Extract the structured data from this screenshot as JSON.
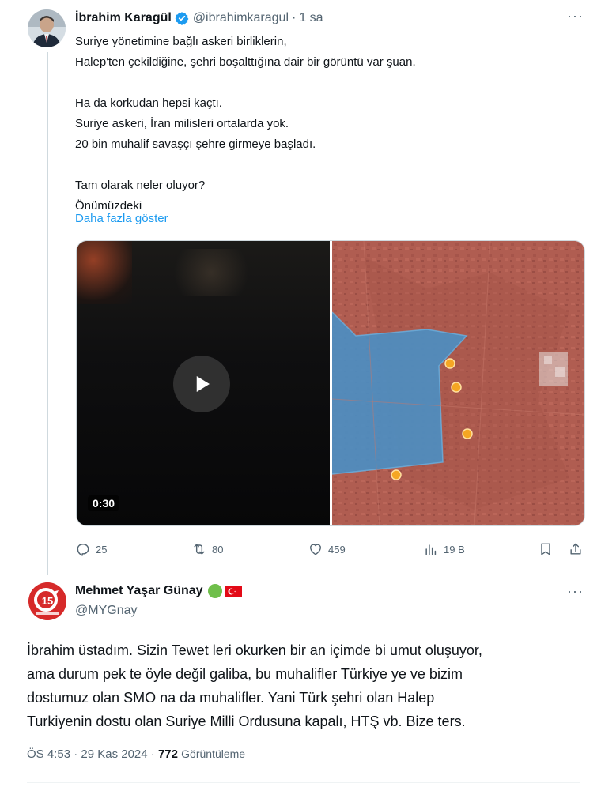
{
  "tweet": {
    "author_name": "İbrahim Karagül",
    "handle": "@ibrahimkaragul",
    "separator": "·",
    "time": "1 sa",
    "lines": [
      "Suriye yönetimine bağlı askeri birliklerin,",
      "Halep'ten çekildiğine, şehri boşalttığına dair bir görüntü var şuan.",
      "",
      "Ha da korkudan hepsi kaçtı.",
      "Suriye askeri, İran milisleri ortalarda yok.",
      "20 bin muhalif savaşçı şehre girmeye başladı.",
      "",
      "Tam olarak neler oluyor?",
      "Önümüzdeki"
    ],
    "show_more": "Daha fazla göster",
    "video_duration": "0:30",
    "replies": "25",
    "reposts": "80",
    "likes": "459",
    "views": "19 B"
  },
  "reply": {
    "author_name": "Mehmet Yaşar Günay",
    "handle": "@MYGnay",
    "lines": [
      "İbrahim üstadım. Sizin Tewet leri okurken bir an içimde bi umut oluşuyor,",
      "ama durum pek te öyle değil galiba, bu muhalifler Türkiye ye ve bizim",
      "dostumuz olan SMO na da muhalifler. Yani Türk şehri olan Halep",
      "Turkiyenin dostu olan Suriye Milli Ordusuna kapalı, HTŞ vb. Bize ters."
    ],
    "timestamp": "ÖS 4:53 · 29 Kas 2024 ·",
    "view_count": "772",
    "view_label": "Görüntüleme"
  },
  "colors": {
    "accent": "#1d9bf0",
    "muted": "#536471",
    "text": "#0f1419",
    "map_control_zone": "#4a8fc4",
    "map_marker": "#f5a623"
  }
}
